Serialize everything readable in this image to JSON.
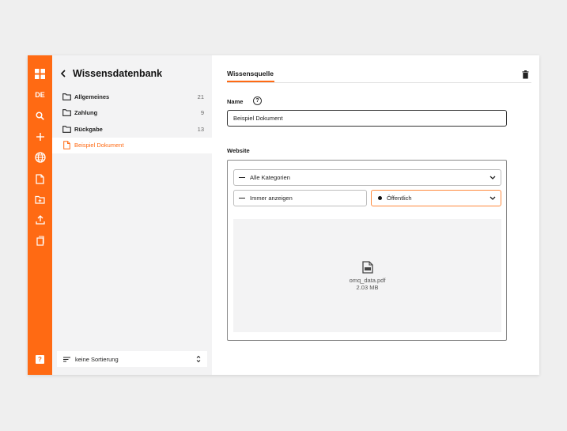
{
  "rail": {
    "language": "DE",
    "icons": [
      "dashboard-icon",
      "search-icon",
      "plus-icon",
      "globe-icon",
      "document-icon",
      "folder-add-icon",
      "upload-icon",
      "copy-icon",
      "help-icon"
    ],
    "help_label": "?"
  },
  "panel": {
    "title": "Wissensdatenbank",
    "items": [
      {
        "label": "Allgemeines",
        "count": "21",
        "icon": "folder-icon"
      },
      {
        "label": "Zahlung",
        "count": "9",
        "icon": "folder-icon"
      },
      {
        "label": "Rückgabe",
        "count": "13",
        "icon": "folder-icon"
      },
      {
        "label": "Beispiel Dokument",
        "count": "",
        "icon": "document-icon",
        "active": true
      }
    ],
    "sort_label": "keine Sortierung"
  },
  "main": {
    "tab_label": "Wissensquelle",
    "name_label": "Name",
    "help_glyph": "?",
    "name_value": "Beispiel Dokument",
    "website_label": "Website",
    "category_select": "Alle Kategorien",
    "display_select": "Immer anzeigen",
    "visibility_select": "Öffentlich",
    "file_name": "omq_data.pdf",
    "file_size": "2.03 MB"
  },
  "colors": {
    "accent": "#ff6a13",
    "panel_bg": "#f3f3f4",
    "page_bg": "#efefef"
  }
}
